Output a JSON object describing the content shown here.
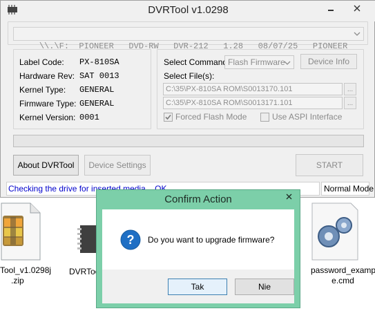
{
  "desktop": {
    "icons": [
      {
        "name": "zip",
        "label_line1": "Tool_v1.0298j",
        "label_line2": ".zip"
      },
      {
        "name": "dvrtool",
        "label_line1": "DVRToo"
      },
      {
        "name": "cmd",
        "label_line1": "password_exampl",
        "label_line2": "e.cmd"
      }
    ]
  },
  "window": {
    "title": "DVRTool v1.0298",
    "drive_select_value": "\\\\.\\F:  PIONEER   DVD-RW   DVR-212   1.28   08/07/25   PIONEER",
    "info": [
      {
        "label": "Label Code:",
        "value": "PX-810SA"
      },
      {
        "label": "Hardware Rev:",
        "value": "SAT 0013"
      },
      {
        "label": "Kernel Type:",
        "value": "GENERAL"
      },
      {
        "label": "Firmware Type:",
        "value": "GENERAL"
      },
      {
        "label": "Kernel Version:",
        "value": "0001"
      }
    ],
    "select_command_label": "Select Command:",
    "select_command_value": "Flash Firmware",
    "device_info_button": "Device Info",
    "select_files_label": "Select File(s):",
    "file1": "C:\\35\\PX-810SA ROM\\S0013170.101",
    "file2": "C:\\35\\PX-810SA ROM\\S0013171.101",
    "browse_label": "...",
    "forced_flash_label": "Forced Flash Mode",
    "forced_flash_checked": true,
    "use_aspi_label": "Use ASPI Interface",
    "use_aspi_checked": false,
    "progress": 0,
    "about_button": "About DVRTool",
    "device_settings_button": "Device Settings",
    "start_button": "START",
    "status_text": "Checking the drive for inserted media... OK",
    "mode_text": "Normal Mode",
    "accent_status_color": "#0000cc"
  },
  "dialog": {
    "title": "Confirm Action",
    "message": "Do you want to upgrade firmware?",
    "yes_button": "Tak",
    "no_button": "Nie",
    "close_label": "x",
    "accent_color": "#7ccfa9",
    "icon": "question-icon"
  }
}
